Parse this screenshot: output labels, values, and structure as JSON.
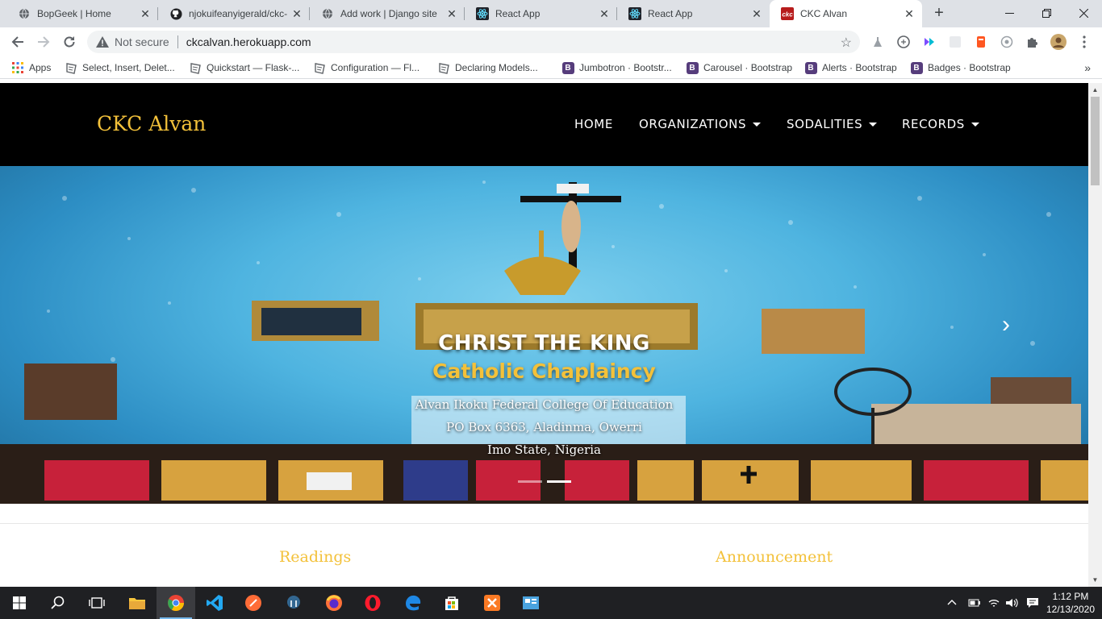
{
  "browser": {
    "tabs": [
      {
        "title": "BopGeek | Home",
        "favicon": "globe-icon"
      },
      {
        "title": "njokuifeanyigerald/ckc-",
        "favicon": "github-icon"
      },
      {
        "title": "Add work | Django site",
        "favicon": "globe-icon"
      },
      {
        "title": "React App",
        "favicon": "react-icon"
      },
      {
        "title": "React App",
        "favicon": "react-icon"
      },
      {
        "title": "CKC Alvan",
        "favicon": "ckc-icon",
        "active": true
      }
    ],
    "omnibox": {
      "security_label": "Not secure",
      "url": "ckcalvan.herokuapp.com"
    },
    "bookmarks": [
      {
        "label": "Apps",
        "icon": "apps-grid-icon"
      },
      {
        "label": "Select, Insert, Delet...",
        "icon": "bookmark-page-icon"
      },
      {
        "label": "Quickstart — Flask-...",
        "icon": "bookmark-page-icon"
      },
      {
        "label": "Configuration — Fl...",
        "icon": "bookmark-page-icon"
      },
      {
        "label": "Declaring Models...",
        "icon": "bookmark-page-icon"
      },
      {
        "label": "Jumbotron · Bootstr...",
        "icon": "bootstrap-icon"
      },
      {
        "label": "Carousel · Bootstrap",
        "icon": "bootstrap-icon"
      },
      {
        "label": "Alerts · Bootstrap",
        "icon": "bootstrap-icon"
      },
      {
        "label": "Badges · Bootstrap",
        "icon": "bootstrap-icon"
      }
    ]
  },
  "site": {
    "brand": "CKC Alvan",
    "nav": [
      "HOME",
      "ORGANIZATIONS",
      "SODALITIES",
      "RECORDS"
    ],
    "hero": {
      "title": "CHRIST THE KING",
      "subtitle": "Catholic Chaplaincy",
      "line1": "Alvan Ikoku Federal College Of Education",
      "line2": "PO Box 6363, Aladinma, Owerri",
      "line3": "Imo State, Nigeria"
    },
    "sections": {
      "left": "Readings",
      "right": "Announcement"
    }
  },
  "taskbar": {
    "clock_time": "1:12 PM",
    "clock_date": "12/13/2020"
  },
  "colors": {
    "brand_gold": "#f3c13a",
    "nav_bg": "#000000"
  }
}
